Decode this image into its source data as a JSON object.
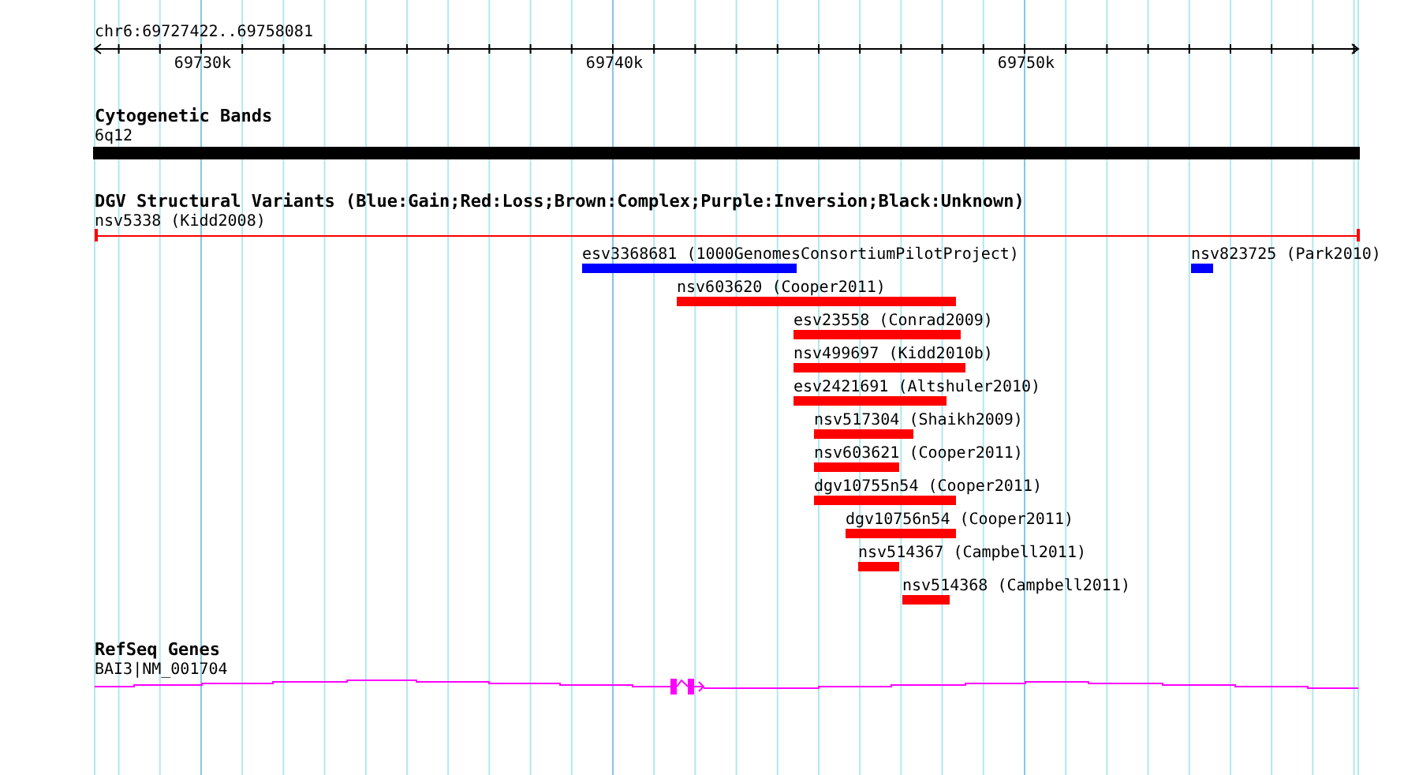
{
  "ruler": {
    "range": "chr6:69727422..69758081",
    "ticks": [
      "69730k",
      "69740k",
      "69750k"
    ]
  },
  "cytogenetic_track": {
    "title": "Cytogenetic Bands",
    "band": "6q12"
  },
  "variant_track": {
    "title": "DGV Structural Variants (Blue:Gain;Red:Loss;Brown:Complex;Purple:Inversion;Black:Unknown)",
    "features": [
      {
        "label": "nsv5338 (Kidd2008)",
        "color": "#ff0000",
        "kind": "line"
      },
      {
        "label": "esv3368681 (1000GenomesConsortiumPilotProject)",
        "color": "#0000ff",
        "kind": "bar"
      },
      {
        "label": "nsv823725 (Park2010)",
        "color": "#0000ff",
        "kind": "bar"
      },
      {
        "label": "nsv603620 (Cooper2011)",
        "color": "#ff0000",
        "kind": "bar"
      },
      {
        "label": "esv23558 (Conrad2009)",
        "color": "#ff0000",
        "kind": "bar"
      },
      {
        "label": "nsv499697 (Kidd2010b)",
        "color": "#ff0000",
        "kind": "bar"
      },
      {
        "label": "esv2421691 (Altshuler2010)",
        "color": "#ff0000",
        "kind": "bar"
      },
      {
        "label": "nsv517304 (Shaikh2009)",
        "color": "#ff0000",
        "kind": "bar"
      },
      {
        "label": "nsv603621 (Cooper2011)",
        "color": "#ff0000",
        "kind": "bar"
      },
      {
        "label": "dgv10755n54 (Cooper2011)",
        "color": "#ff0000",
        "kind": "bar"
      },
      {
        "label": "dgv10756n54 (Cooper2011)",
        "color": "#ff0000",
        "kind": "bar"
      },
      {
        "label": "nsv514367 (Campbell2011)",
        "color": "#ff0000",
        "kind": "bar"
      },
      {
        "label": "nsv514368 (Campbell2011)",
        "color": "#ff0000",
        "kind": "bar"
      }
    ]
  },
  "gene_track": {
    "title": "RefSeq Genes",
    "gene": "BAI3|NM_001704"
  }
}
